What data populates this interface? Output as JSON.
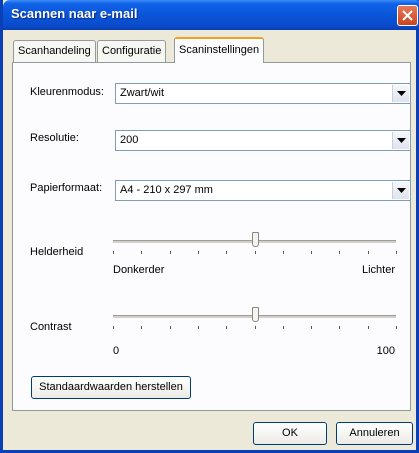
{
  "window": {
    "title": "Scannen naar e-mail"
  },
  "tabs": [
    {
      "label": "Scanhandeling"
    },
    {
      "label": "Configuratie"
    },
    {
      "label": "Scaninstellingen"
    }
  ],
  "settings": {
    "color_mode": {
      "label": "Kleurenmodus:",
      "value": "Zwart/wit"
    },
    "resolution": {
      "label": "Resolutie:",
      "value": "200"
    },
    "paper_size": {
      "label": "Papierformaat:",
      "value": "A4 - 210 x 297 mm"
    }
  },
  "brightness": {
    "label": "Helderheid",
    "min_label": "Donkerder",
    "max_label": "Lichter",
    "level": 0.5
  },
  "contrast": {
    "label": "Contrast",
    "min_label": "0",
    "max_label": "100",
    "level": 0.5
  },
  "buttons": {
    "defaults": "Standaardwaarden herstellen",
    "ok": "OK",
    "cancel": "Annuleren"
  }
}
